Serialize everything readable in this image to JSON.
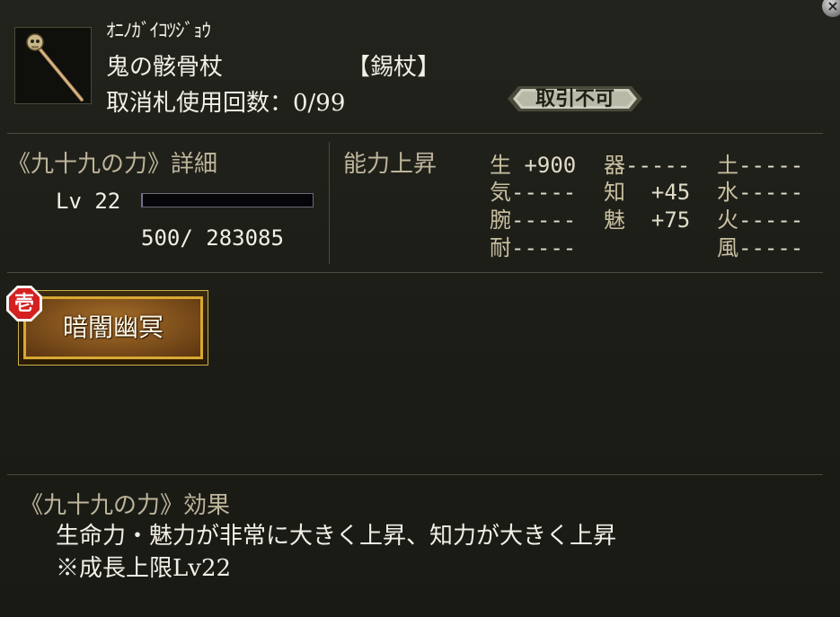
{
  "item": {
    "kana": "ｵﾆﾉｶﾞｲｺﾂｼﾞｮｳ",
    "name": "鬼の骸骨杖",
    "type": "【錫杖】",
    "uses": "取消札使用回数：0/99",
    "trade": "取引不可",
    "icon": "skull-staff-icon"
  },
  "detail": {
    "title": "《九十九の力》詳細",
    "level": "Lv 22",
    "exp_text": "500/  283085",
    "exp_progress": 0.0018
  },
  "stats": {
    "head": "能力上昇",
    "col1": [
      {
        "k": "生",
        "v": " +900"
      },
      {
        "k": "気",
        "v": "-----"
      },
      {
        "k": "腕",
        "v": "-----"
      },
      {
        "k": "耐",
        "v": "-----"
      }
    ],
    "col2": [
      {
        "k": "器",
        "v": "-----"
      },
      {
        "k": "知",
        "v": "  +45"
      },
      {
        "k": "魅",
        "v": "  +75"
      }
    ],
    "col3": [
      {
        "k": "土",
        "v": "-----"
      },
      {
        "k": "水",
        "v": "-----"
      },
      {
        "k": "火",
        "v": "-----"
      },
      {
        "k": "風",
        "v": "-----"
      }
    ]
  },
  "skill": {
    "name": "暗闇幽冥",
    "badge": "壱"
  },
  "effect": {
    "title": "《九十九の力》効果",
    "desc": "生命力・魅力が非常に大きく上昇、知力が大きく上昇",
    "cap": "※成長上限Lv22"
  },
  "colors": {
    "label": "#bdb59a",
    "text": "#f2f0e6",
    "skill_gold": "#d9a833",
    "badge_red": "#d42020"
  }
}
